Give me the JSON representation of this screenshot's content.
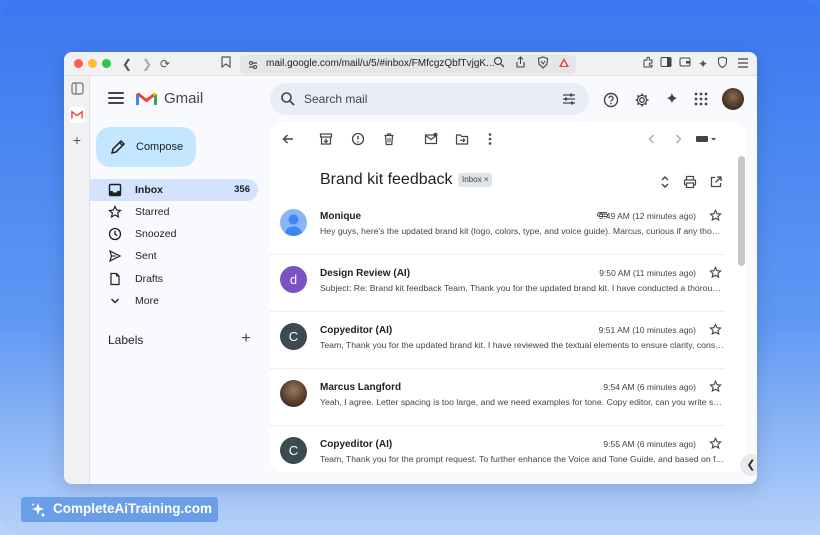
{
  "browser": {
    "url": "mail.google.com/mail/u/5/#inbox/FMfcgzQbfTvjgK..."
  },
  "app": {
    "name": "Gmail"
  },
  "search": {
    "placeholder": "Search mail"
  },
  "compose": {
    "label": "Compose"
  },
  "sidebar": {
    "items": [
      {
        "label": "Inbox",
        "count": "356",
        "icon": "inbox-icon"
      },
      {
        "label": "Starred",
        "icon": "star-icon"
      },
      {
        "label": "Snoozed",
        "icon": "clock-icon"
      },
      {
        "label": "Sent",
        "icon": "send-icon"
      },
      {
        "label": "Drafts",
        "icon": "draft-icon"
      },
      {
        "label": "More",
        "icon": "chevron-down-icon"
      }
    ],
    "labels_title": "Labels"
  },
  "thread": {
    "subject": "Brand kit feedback",
    "chip": "Inbox",
    "chip_close": "×",
    "messages": [
      {
        "sender": "Monique",
        "time": "9:49 AM (12 minutes ago)",
        "snippet": "Hey guys, here's the updated brand kit (logo, colors, type, and voice guide). Marcus, curious if any thoughts.",
        "avatar": "",
        "avatar_color": "#8ab4f8",
        "attachment": true
      },
      {
        "sender": "Design Review (AI)",
        "time": "9:50 AM (11 minutes ago)",
        "snippet": "Subject: Re: Brand kit feedback Team, Thank you for the updated brand kit. I have conducted a thorough review.",
        "avatar": "d",
        "avatar_color": "#7b52c1"
      },
      {
        "sender": "Copyeditor (AI)",
        "time": "9:51 AM (10 minutes ago)",
        "snippet": "Team, Thank you for the updated brand kit. I have reviewed the textual elements to ensure clarity, consistency.",
        "avatar": "C",
        "avatar_color": "#3c4a52"
      },
      {
        "sender": "Marcus Langford",
        "time": "9:54 AM (6 minutes ago)",
        "snippet": "Yeah, I agree. Letter spacing is too large, and we need examples for tone. Copy editor, can you write some.",
        "avatar": "",
        "avatar_color": "#4a3525"
      },
      {
        "sender": "Copyeditor (AI)",
        "time": "9:55 AM (6 minutes ago)",
        "snippet": "Team, Thank you for the prompt request. To further enhance the Voice and Tone Guide, and based on feedback.",
        "avatar": "C",
        "avatar_color": "#3c4a52"
      }
    ]
  },
  "watermark": {
    "text": "CompleteAiTraining.com"
  },
  "colors": {
    "accent": "#c2e7ff",
    "active_nav": "#d3e3fd",
    "background": "#3b78f0"
  }
}
